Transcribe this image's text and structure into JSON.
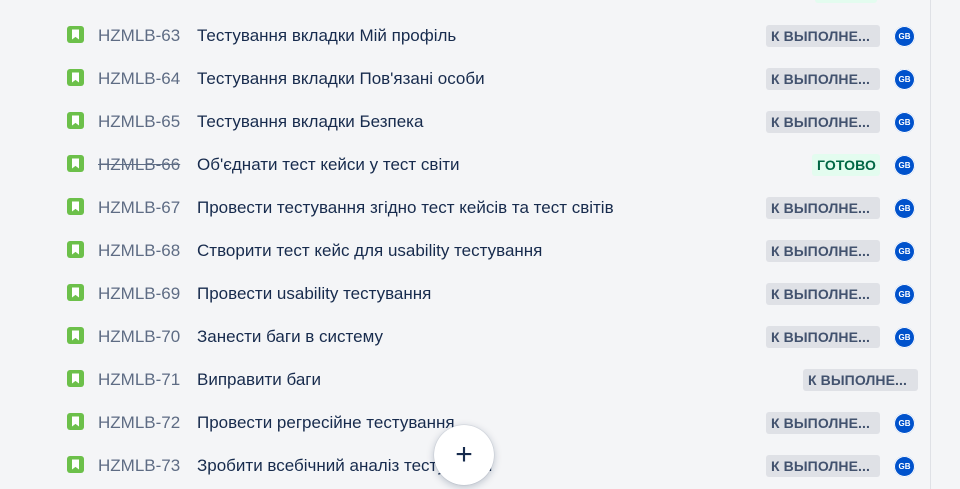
{
  "issues": [
    {
      "key": "HZMLB-63",
      "summary": "Тестування вкладки Мій профіль",
      "status": "К ВЫПОЛНЕ...",
      "status_type": "todo",
      "assignee": "GB",
      "done": false
    },
    {
      "key": "HZMLB-64",
      "summary": "Тестування вкладки Пов'язані особи",
      "status": "К ВЫПОЛНЕ...",
      "status_type": "todo",
      "assignee": "GB",
      "done": false
    },
    {
      "key": "HZMLB-65",
      "summary": "Тестування вкладки Безпека",
      "status": "К ВЫПОЛНЕ...",
      "status_type": "todo",
      "assignee": "GB",
      "done": false
    },
    {
      "key": "HZMLB-66",
      "summary": "Об'єднати тест кейси у тест світи",
      "status": "ГОТОВО",
      "status_type": "done",
      "assignee": "GB",
      "done": true
    },
    {
      "key": "HZMLB-67",
      "summary": "Провести тестування згідно тест кейсів та тест світів",
      "status": "К ВЫПОЛНЕ...",
      "status_type": "todo",
      "assignee": "GB",
      "done": false
    },
    {
      "key": "HZMLB-68",
      "summary": "Створити тест кейс для usability тестування",
      "status": "К ВЫПОЛНЕ...",
      "status_type": "todo",
      "assignee": "GB",
      "done": false
    },
    {
      "key": "HZMLB-69",
      "summary": "Провести usability тестування",
      "status": "К ВЫПОЛНЕ...",
      "status_type": "todo",
      "assignee": "GB",
      "done": false
    },
    {
      "key": "HZMLB-70",
      "summary": "Занести баги в систему",
      "status": "К ВЫПОЛНЕ...",
      "status_type": "todo",
      "assignee": "GB",
      "done": false
    },
    {
      "key": "HZMLB-71",
      "summary": "Виправити баги",
      "status": "К ВЫПОЛНЕ...",
      "status_type": "todo",
      "assignee": "",
      "done": false
    },
    {
      "key": "HZMLB-72",
      "summary": "Провести регресійне тестування",
      "status": "К ВЫПОЛНЕ...",
      "status_type": "todo",
      "assignee": "GB",
      "done": false
    },
    {
      "key": "HZMLB-73",
      "summary": "Зробити всебічний аналіз тестування",
      "status": "К ВЫПОЛНЕ...",
      "status_type": "todo",
      "assignee": "GB",
      "done": false
    }
  ],
  "create_button": {
    "label": "+",
    "icon": "plus-icon"
  },
  "colors": {
    "story_icon": "#6cc04a",
    "avatar_bg": "#0052cc",
    "status_todo_bg": "#dfe1e6",
    "status_done_bg": "#e3fcef",
    "status_done_text": "#006644"
  }
}
